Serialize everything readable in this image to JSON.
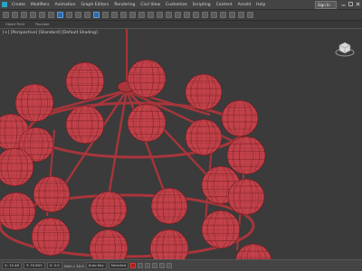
{
  "menu": {
    "items": [
      "Create",
      "Modifiers",
      "Animation",
      "Graph Editors",
      "Rendering",
      "Civil View",
      "Customize",
      "Scripting",
      "Content",
      "Arnold",
      "Help"
    ],
    "signin_label": "Sign In"
  },
  "ribbon": {
    "tabs": [
      "Object Paint",
      "Populate"
    ]
  },
  "viewport": {
    "label": "[+] [Perspective] [Standard] [Default Shading]"
  },
  "status": {
    "coords": [
      "X: 15.48",
      "Y: 70.803",
      "Z: 0.0"
    ],
    "grid": "Grid = 10.0",
    "autokey": "Auto Key",
    "setkey": "Set Key",
    "selected": "Selected"
  },
  "colors": {
    "sphere": "#c2424a",
    "frame": "#a8353b",
    "wire": "#6e1a1e",
    "background": "#3b3b3b"
  }
}
